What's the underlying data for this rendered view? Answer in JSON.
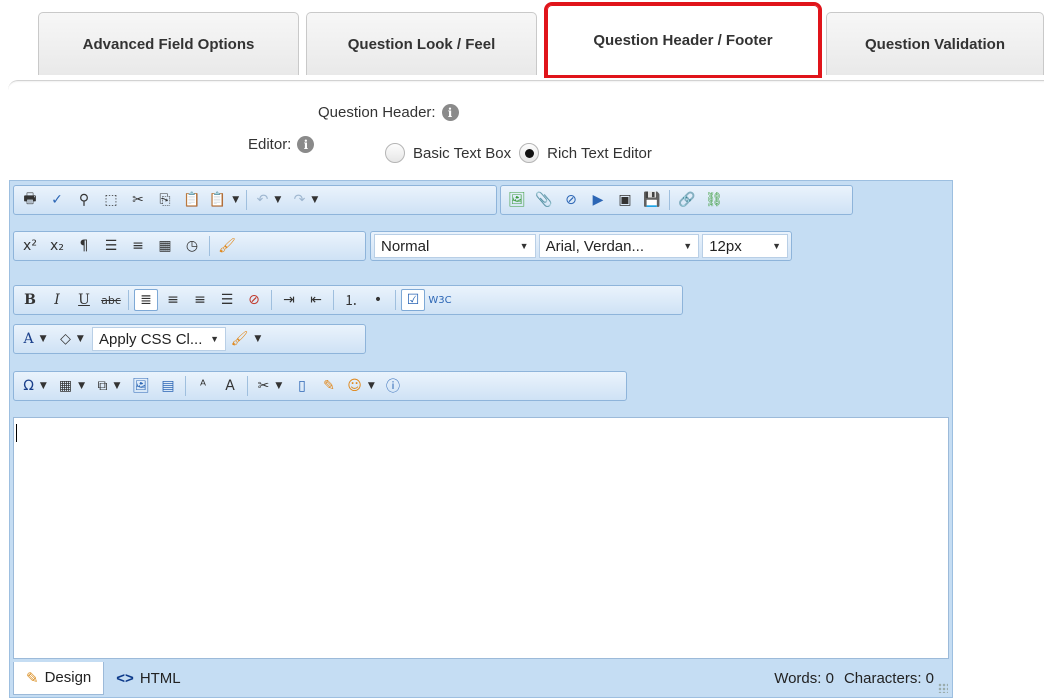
{
  "tabs": [
    {
      "label": "Advanced Field Options"
    },
    {
      "label": "Question Look / Feel"
    },
    {
      "label": "Question Header / Footer"
    },
    {
      "label": "Question Validation"
    }
  ],
  "question_header": {
    "label": "Question Header:"
  },
  "editor_choice": {
    "label": "Editor:",
    "option_basic": "Basic Text Box",
    "option_rich": "Rich Text Editor",
    "selected": "Rich Text Editor"
  },
  "toolbar": {
    "paragraph_style": "Normal",
    "font_name": "Arial, Verdan...",
    "font_size": "12px",
    "css_class": "Apply CSS Cl..."
  },
  "statusbar": {
    "design_label": "Design",
    "html_label": "HTML",
    "words": "Words: 0",
    "characters": "Characters: 0"
  },
  "colors": {
    "highlight": "#e0141a",
    "editor_bg": "#c5ddf3"
  }
}
